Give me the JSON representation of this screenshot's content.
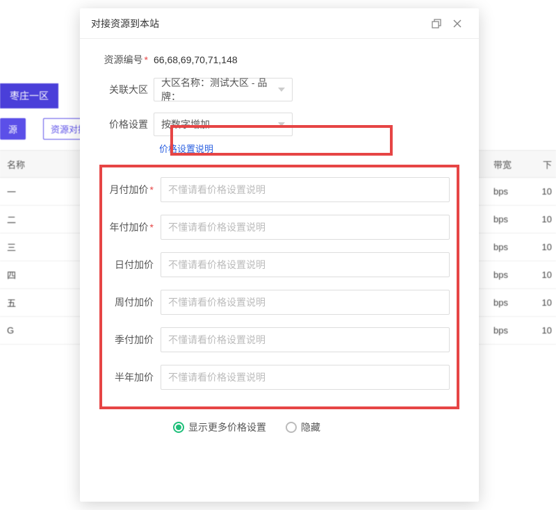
{
  "background": {
    "tag": "枣庄一区",
    "btn1": "源",
    "btn2": "资源对接",
    "header_name": "名称",
    "header_bw": "带宽",
    "header_tail": "下",
    "rows": [
      {
        "name": "一",
        "bw": "bps",
        "tail": "10"
      },
      {
        "name": "二",
        "bw": "bps",
        "tail": "10"
      },
      {
        "name": "三",
        "bw": "bps",
        "tail": "10"
      },
      {
        "name": "四",
        "bw": "bps",
        "tail": "10"
      },
      {
        "name": "五",
        "bw": "bps",
        "tail": "10"
      },
      {
        "name": "G",
        "bw": "bps",
        "tail": "10"
      }
    ]
  },
  "modal": {
    "title": "对接资源到本站",
    "fields": {
      "resource_id": {
        "label": "资源编号",
        "value": "66,68,69,70,71,148",
        "required": true
      },
      "region": {
        "label": "关联大区",
        "value": "大区名称：测试大区 - 品牌："
      },
      "price_mode": {
        "label": "价格设置",
        "value": "按数字增加"
      }
    },
    "price_help_link": "价格设置说明",
    "inputs": [
      {
        "label": "月付加价",
        "required": true,
        "placeholder": "不懂请看价格设置说明"
      },
      {
        "label": "年付加价",
        "required": true,
        "placeholder": "不懂请看价格设置说明"
      },
      {
        "label": "日付加价",
        "required": false,
        "placeholder": "不懂请看价格设置说明"
      },
      {
        "label": "周付加价",
        "required": false,
        "placeholder": "不懂请看价格设置说明"
      },
      {
        "label": "季付加价",
        "required": false,
        "placeholder": "不懂请看价格设置说明"
      },
      {
        "label": "半年加价",
        "required": false,
        "placeholder": "不懂请看价格设置说明"
      }
    ],
    "radio": {
      "show_more": "显示更多价格设置",
      "hide": "隐藏",
      "selected": "show_more"
    }
  }
}
